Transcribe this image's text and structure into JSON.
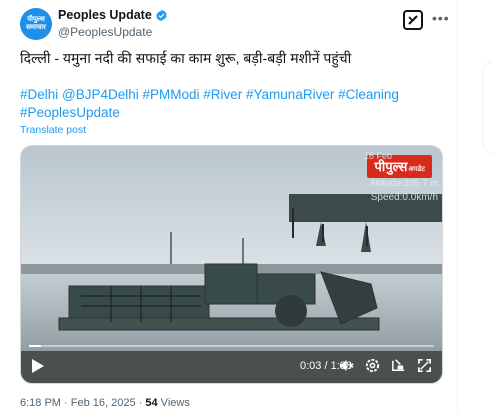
{
  "author": {
    "display_name": "Peoples Update",
    "handle": "@PeoplesUpdate",
    "avatar_text_line1": "पीपुल्स",
    "avatar_text_line2": "समाचार"
  },
  "tweet": {
    "text": "दिल्ली - यमुना नदी की सफाई का काम शुरू, बड़ी-बड़ी मशीनें पहुंची",
    "hashtags": "#Delhi @BJP4Delhi #PMModi #River #YamunaRiver #Cleaning #PeoplesUpdate",
    "translate_label": "Translate post"
  },
  "video": {
    "logo_main": "पीपुल्स",
    "logo_sub": "अपडेट",
    "overlay_date": "16 Feb",
    "overlay_altitude": "Altitude:205.7 m",
    "overlay_speed": "Speed:0.0km/h",
    "time_display": "0:03 / 1:38",
    "progress": 0.03
  },
  "meta": {
    "time": "6:18 PM",
    "separator1": " · ",
    "date": "Feb 16, 2025",
    "separator2": " · ",
    "views_count": "54",
    "views_label": " Views"
  },
  "colors": {
    "accent": "#1d9bf0",
    "logo_red": "#d92a1c",
    "text_primary": "#0f1419",
    "text_secondary": "#536471"
  },
  "icons": [
    "verified-badge-icon",
    "grok-icon",
    "more-icon",
    "play-icon",
    "volume-icon",
    "settings-icon",
    "pip-icon",
    "fullscreen-icon"
  ]
}
